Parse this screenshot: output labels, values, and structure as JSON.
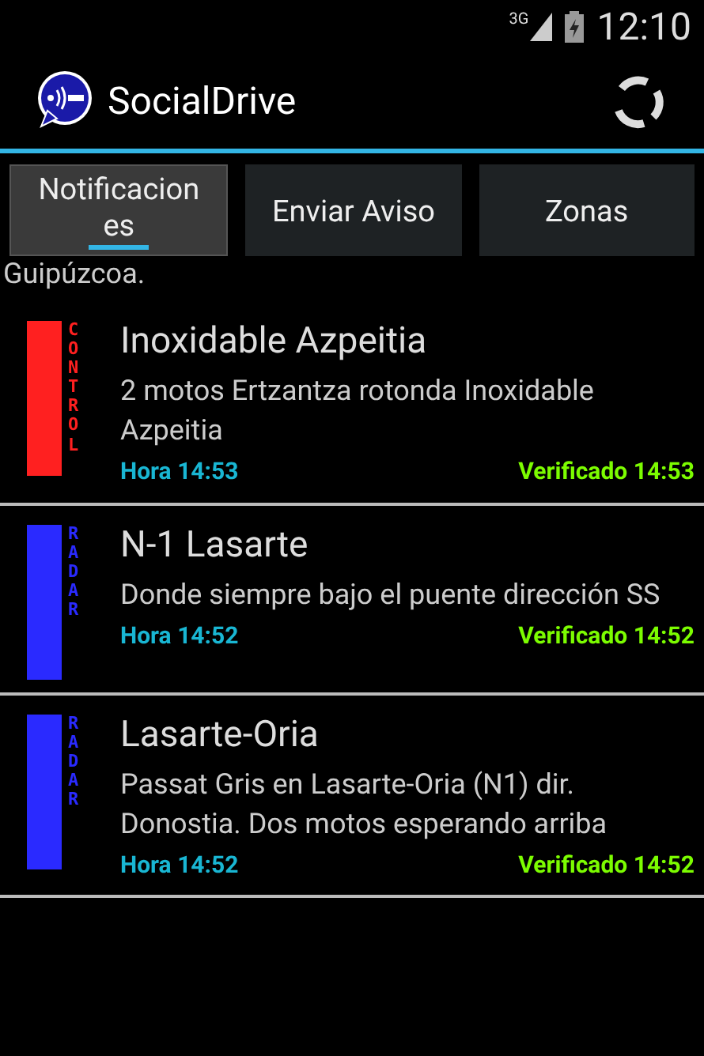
{
  "status_bar": {
    "network": "3G",
    "time": "12:10"
  },
  "action_bar": {
    "title": "SocialDrive"
  },
  "tabs": [
    {
      "label": "Notificaciones",
      "selected": true
    },
    {
      "label": "Enviar Aviso",
      "selected": false
    },
    {
      "label": "Zonas",
      "selected": false
    }
  ],
  "region": "Guipúzcoa.",
  "alerts": [
    {
      "category": "CONTROL",
      "color": "#ff2020",
      "title": "Inoxidable Azpeitia",
      "description": "2 motos Ertzantza rotonda Inoxidable Azpeitia",
      "time": "Hora 14:53",
      "verified": "Verificado 14:53"
    },
    {
      "category": "RADAR",
      "color": "#2a2aff",
      "title": "N-1 Lasarte",
      "description": "Donde siempre bajo el puente dirección SS",
      "time": "Hora 14:52",
      "verified": "Verificado 14:52"
    },
    {
      "category": "RADAR",
      "color": "#2a2aff",
      "title": "Lasarte-Oria",
      "description": "Passat Gris en Lasarte-Oria (N1) dir. Donostia. Dos motos esperando arriba",
      "time": "Hora 14:52",
      "verified": "Verificado 14:52"
    }
  ]
}
